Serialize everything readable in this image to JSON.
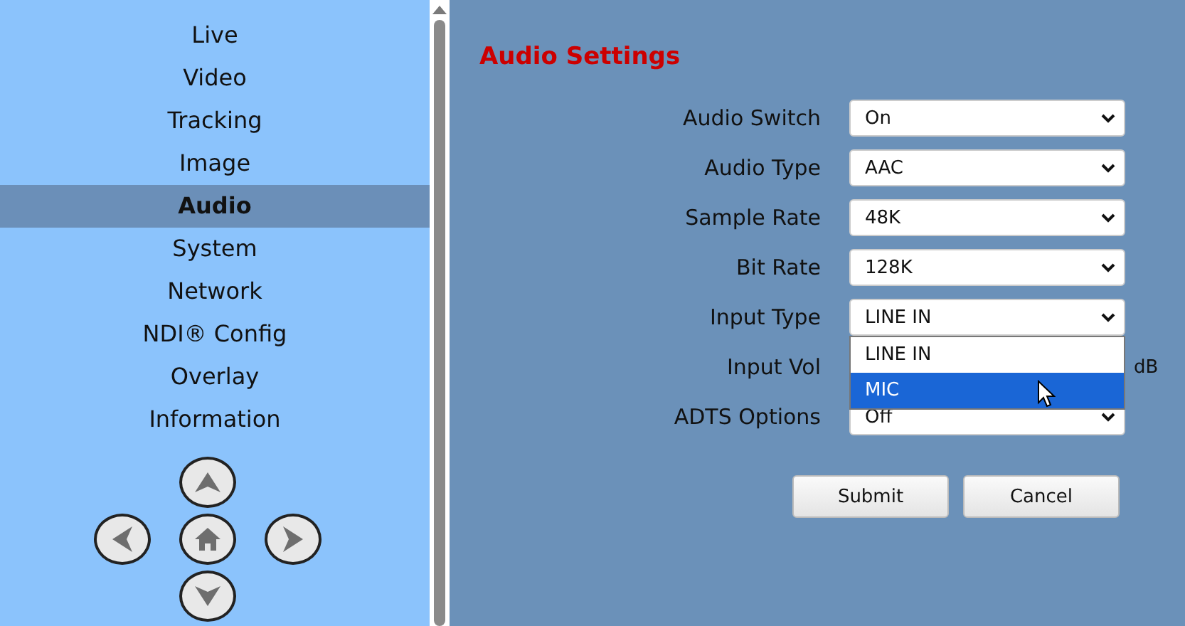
{
  "sidebar": {
    "items": [
      {
        "label": "Live",
        "selected": false
      },
      {
        "label": "Video",
        "selected": false
      },
      {
        "label": "Tracking",
        "selected": false
      },
      {
        "label": "Image",
        "selected": false
      },
      {
        "label": "Audio",
        "selected": true
      },
      {
        "label": "System",
        "selected": false
      },
      {
        "label": "Network",
        "selected": false
      },
      {
        "label": "NDI® Config",
        "selected": false
      },
      {
        "label": "Overlay",
        "selected": false
      },
      {
        "label": "Information",
        "selected": false
      }
    ],
    "pan_buttons": [
      {
        "kind": "up"
      },
      {
        "kind": "left"
      },
      {
        "kind": "home"
      },
      {
        "kind": "right"
      },
      {
        "kind": "down"
      }
    ]
  },
  "title": "Audio Settings",
  "form": {
    "rows": [
      {
        "label": "Audio Switch",
        "value": "On"
      },
      {
        "label": "Audio Type",
        "value": "AAC"
      },
      {
        "label": "Sample Rate",
        "value": "48K"
      },
      {
        "label": "Bit Rate",
        "value": "128K"
      },
      {
        "label": "Input Type",
        "value": "LINE IN",
        "open": true,
        "options": [
          {
            "label": "LINE IN",
            "highlighted": false
          },
          {
            "label": "MIC",
            "highlighted": true
          }
        ]
      },
      {
        "label": "Input Vol",
        "unit": "dB"
      },
      {
        "label": "ADTS Options",
        "value": "Off"
      }
    ]
  },
  "buttons": [
    "Submit",
    "Cancel"
  ]
}
